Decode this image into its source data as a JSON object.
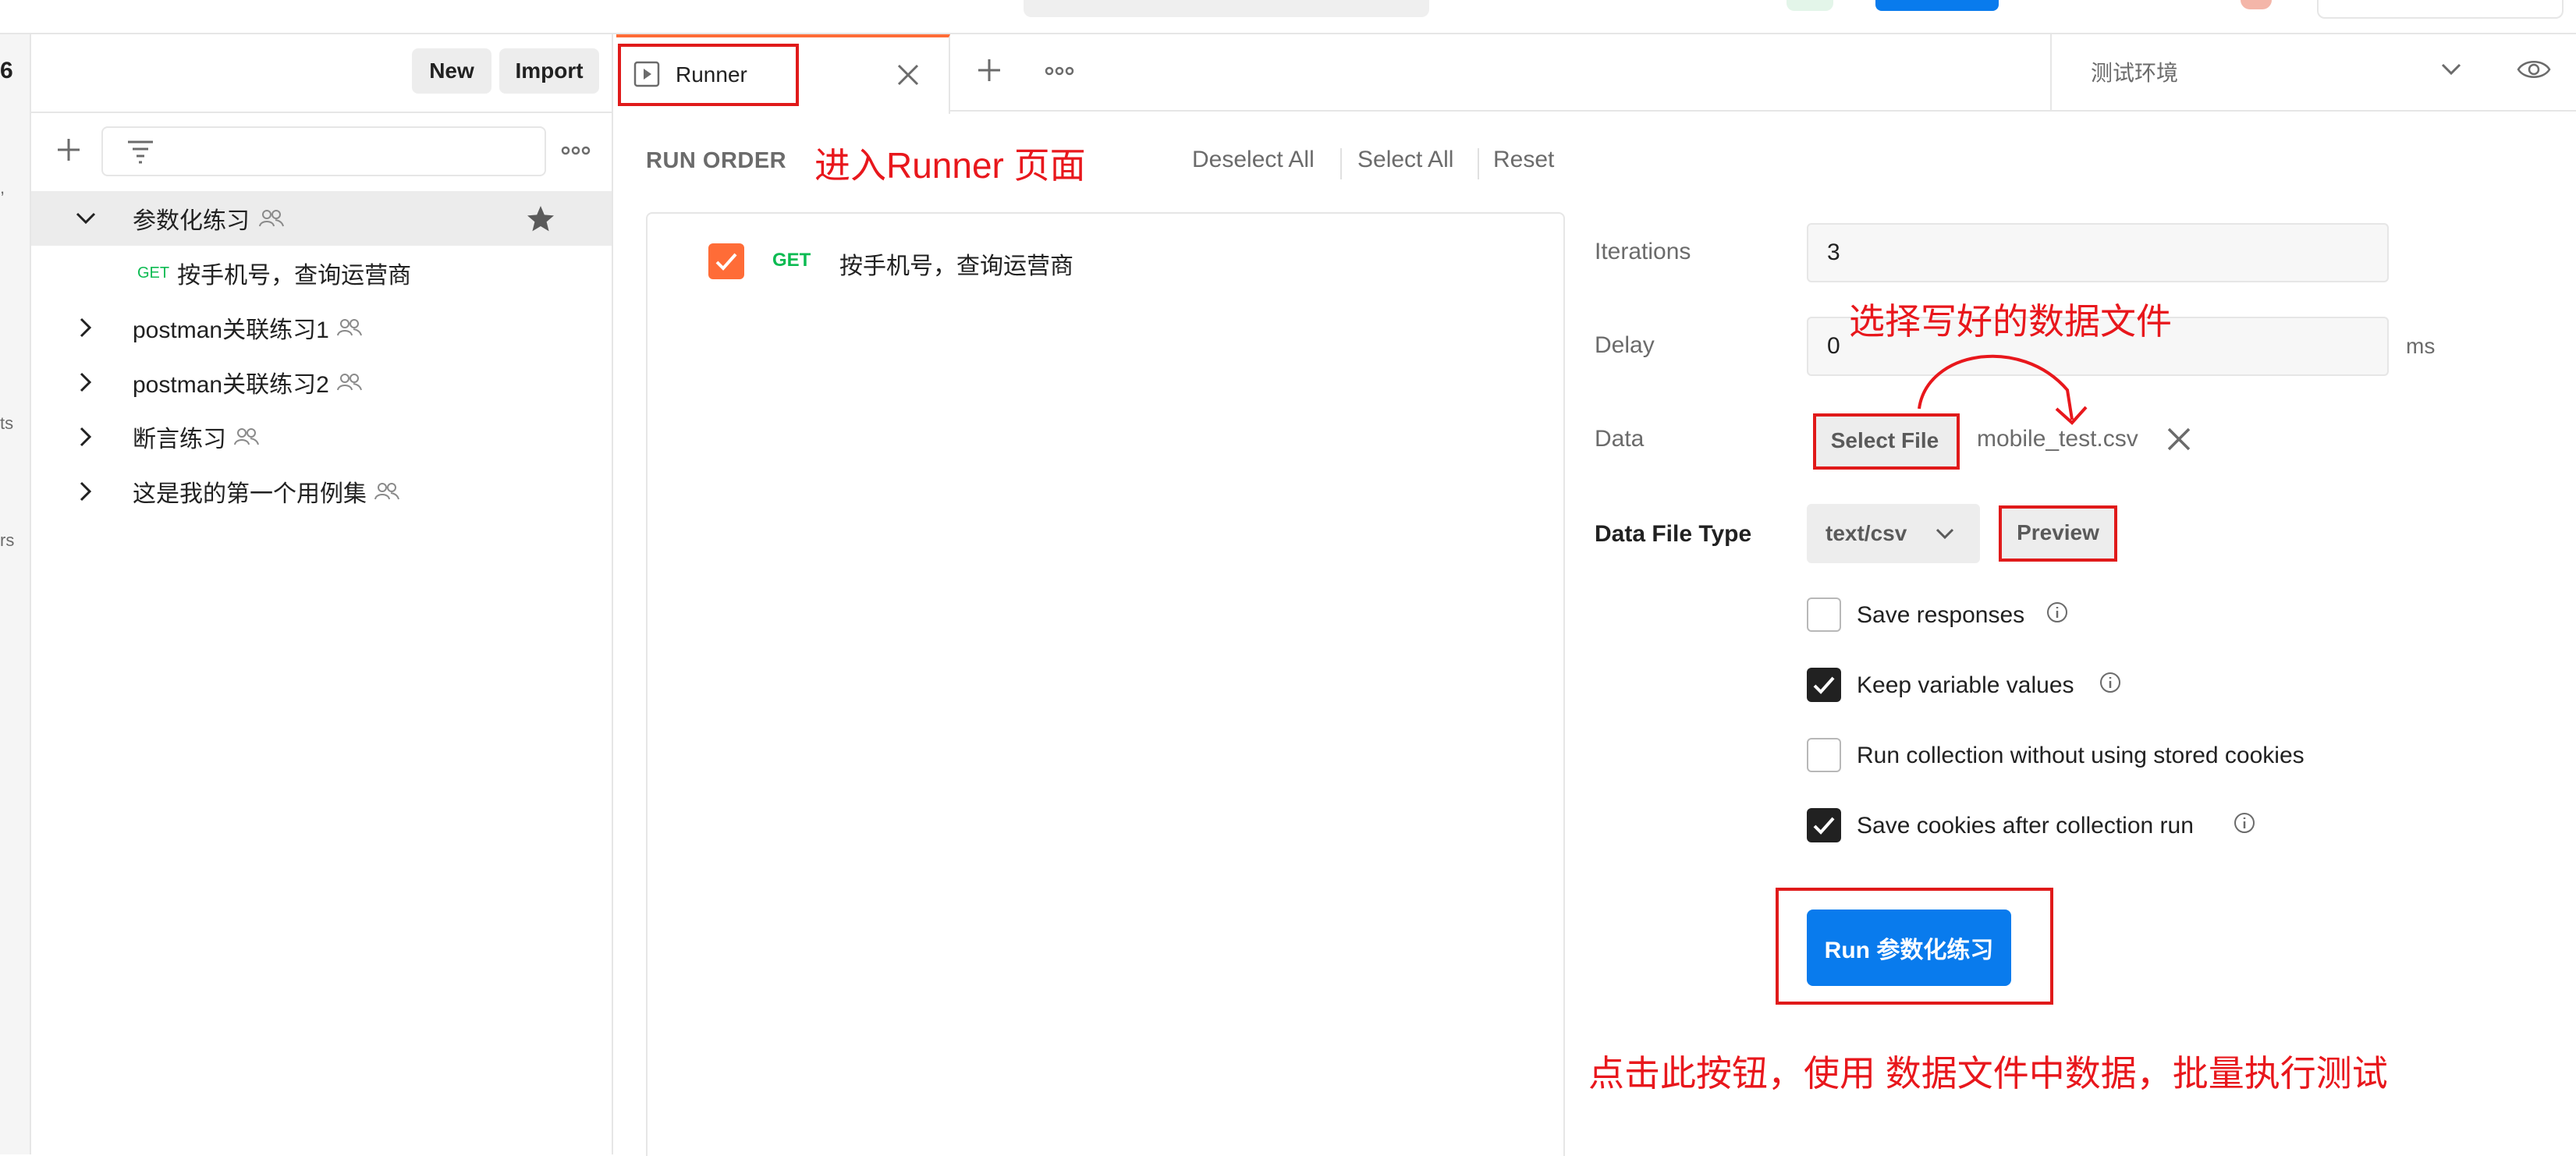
{
  "sidebar": {
    "workspace_name": "6",
    "new_label": "New",
    "import_label": "Import",
    "strip_fragments": [
      ",",
      "ts",
      "rs"
    ],
    "collections": [
      {
        "name": "参数化练习",
        "expanded": true
      },
      {
        "name": "postman关联练习1"
      },
      {
        "name": "postman关联练习2"
      },
      {
        "name": "断言练习"
      },
      {
        "name": "这是我的第一个用例集"
      }
    ],
    "request": {
      "method": "GET",
      "name": "按手机号，查询运营商"
    }
  },
  "tabs": [
    {
      "label": "Runner"
    }
  ],
  "environment": {
    "selected": "测试环境"
  },
  "runner": {
    "run_order_label": "RUN ORDER",
    "deselect_all": "Deselect All",
    "select_all": "Select All",
    "reset": "Reset",
    "order_items": [
      {
        "method": "GET",
        "name": "按手机号，查询运营商",
        "checked": true
      }
    ],
    "iterations_label": "Iterations",
    "iterations_value": "3",
    "delay_label": "Delay",
    "delay_value": "0",
    "delay_unit": "ms",
    "data_label": "Data",
    "select_file_label": "Select File",
    "file_name": "mobile_test.csv",
    "data_file_type_label": "Data File Type",
    "data_file_type_value": "text/csv",
    "preview_label": "Preview",
    "options": [
      {
        "label": "Save responses",
        "checked": false,
        "info": true
      },
      {
        "label": "Keep variable values",
        "checked": true,
        "info": true
      },
      {
        "label": "Run collection without using stored cookies",
        "checked": false,
        "info": false
      },
      {
        "label": "Save cookies after collection run",
        "checked": true,
        "info": true
      }
    ],
    "run_button_label": "Run 参数化练习"
  },
  "annotations": {
    "runner_note": "进入Runner 页面",
    "file_note": "选择写好的数据文件",
    "run_note": "点击此按钮，使用 数据文件中数据，批量执行测试"
  },
  "colors": {
    "accent_orange": "#ff6c37",
    "primary_blue": "#097bed",
    "get_green": "#0cbb52",
    "annotation_red": "#e8171c"
  }
}
